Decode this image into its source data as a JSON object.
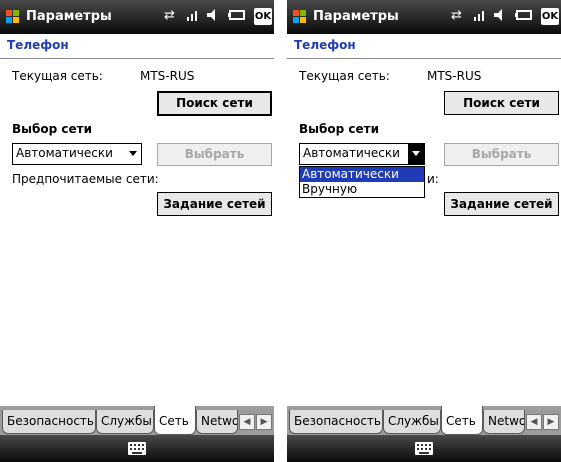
{
  "screens": [
    {
      "title": "Параметры",
      "ok_label": "OK",
      "page_title": "Телефон",
      "current_network_label": "Текущая сеть:",
      "current_network_value": "MTS-RUS",
      "search_button": "Поиск сети",
      "network_selection_heading": "Выбор сети",
      "selection_mode_value": "Автоматически",
      "select_button": "Выбрать",
      "preferred_networks_label": "Предпочитаемые сети:",
      "set_networks_button": "Задание сетей",
      "tabs": [
        "Безопасность",
        "Службы",
        "Сеть",
        "Network"
      ],
      "active_tab": "Сеть"
    },
    {
      "title": "Параметры",
      "ok_label": "OK",
      "page_title": "Телефон",
      "current_network_label": "Текущая сеть:",
      "current_network_value": "MTS-RUS",
      "search_button": "Поиск сети",
      "network_selection_heading": "Выбор сети",
      "selection_mode_value": "Автоматически",
      "dropdown_options": [
        "Автоматически",
        "Вручную"
      ],
      "dropdown_selected": "Автоматически",
      "partial_label_visible": "и:",
      "select_button": "Выбрать",
      "set_networks_button": "Задание сетей",
      "tabs": [
        "Безопасность",
        "Службы",
        "Сеть",
        "Network"
      ],
      "active_tab": "Сеть"
    }
  ],
  "colors": {
    "title_bar": "#1a1a1a",
    "page_title_text": "#1f3cb4",
    "selection_highlight": "#1f3cb4",
    "disabled_text": "#a8a8a8"
  }
}
